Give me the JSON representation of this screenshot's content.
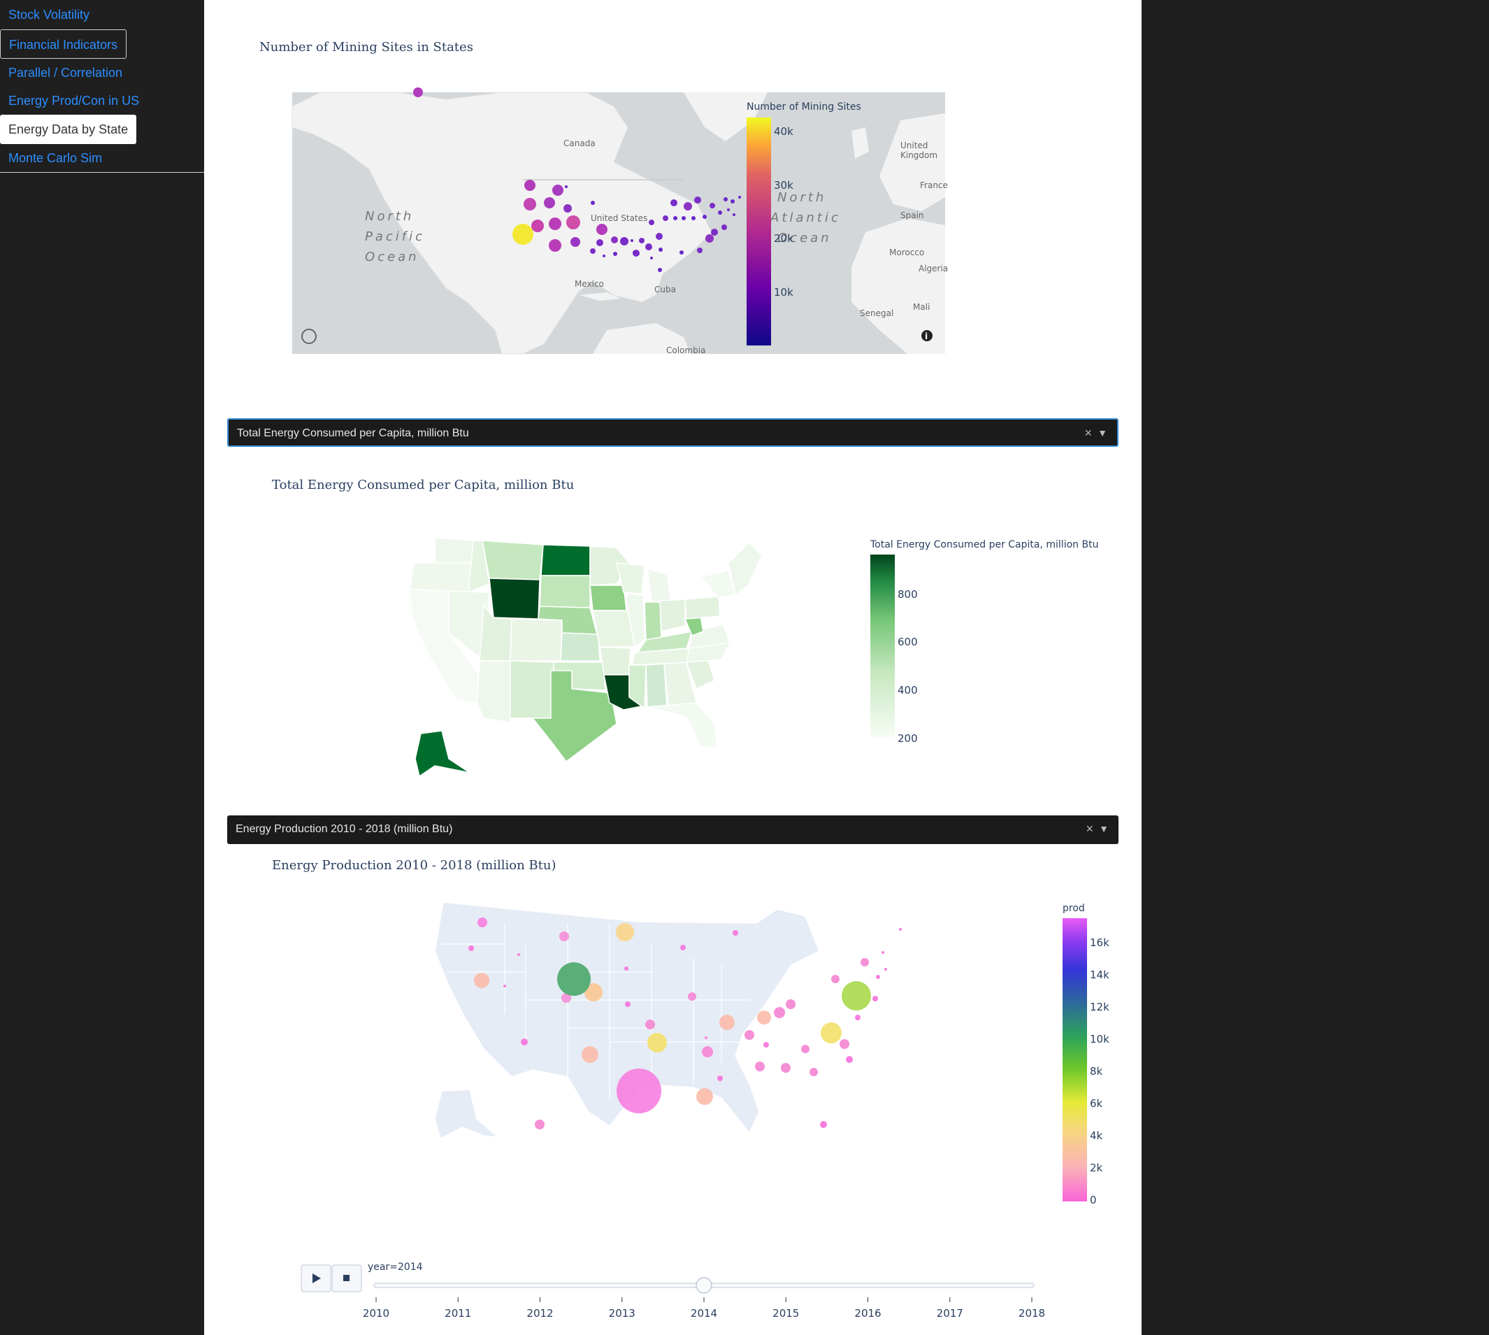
{
  "nav": {
    "items": [
      {
        "label": "Stock Volatility"
      },
      {
        "label": "Financial Indicators"
      },
      {
        "label": "Parallel / Correlation"
      },
      {
        "label": "Energy Prod/Con in US"
      },
      {
        "label": "Energy Data by State"
      },
      {
        "label": "Monte Carlo Sim"
      }
    ]
  },
  "mining_chart": {
    "title": "Number of Mining Sites in States",
    "colorbar_title": "Number of Mining Sites",
    "colorbar_ticks": [
      "40k",
      "30k",
      "20k",
      "10k"
    ],
    "map_labels": {
      "canada": "Canada",
      "united_states": "United States",
      "mexico": "Mexico",
      "cuba": "Cuba",
      "colombia": "Colombia",
      "north_pacific": [
        "North",
        "Pacific",
        "Ocean"
      ],
      "north_atlantic": [
        "North",
        "Atlantic",
        "Ocean"
      ],
      "uk": [
        "United",
        "Kingdom"
      ],
      "france": "France",
      "spain": "Spain",
      "morocco": "Morocco",
      "algeria": "Algeria",
      "senegal": "Senegal",
      "mali": "Mali"
    }
  },
  "dropdown1": {
    "value": "Total Energy Consumed per Capita, million Btu"
  },
  "choropleth_chart": {
    "title": "Total Energy Consumed per Capita, million Btu",
    "colorbar_title": "Total Energy Consumed per Capita, million Btu",
    "colorbar_ticks": [
      "800",
      "600",
      "400",
      "200"
    ]
  },
  "dropdown2": {
    "value": "Energy Production 2010 - 2018 (million Btu)"
  },
  "bubble_chart": {
    "title": "Energy Production 2010 - 2018 (million Btu)",
    "colorbar_title": "prod",
    "colorbar_ticks": [
      "16k",
      "14k",
      "12k",
      "10k",
      "8k",
      "6k",
      "4k",
      "2k",
      "0"
    ]
  },
  "slider": {
    "current_label": "year=2014",
    "years": [
      "2010",
      "2011",
      "2012",
      "2013",
      "2014",
      "2015",
      "2016",
      "2017",
      "2018"
    ],
    "current_index": 4,
    "play_icon": "play-icon",
    "stop_icon": "stop-icon"
  },
  "colors": {
    "link": "#2c8eff",
    "sidebar_bg": "#1f1f1f",
    "dropdown_bg": "#1b1b1b",
    "focus_border": "#3b8fd9"
  },
  "chart_data": [
    {
      "type": "scatter",
      "title": "Number of Mining Sites in States",
      "colorbar": {
        "title": "Number of Mining Sites",
        "range": [
          0,
          45000
        ],
        "ticks": [
          10000,
          20000,
          30000,
          40000
        ]
      },
      "note": "bubble map of mining sites per state"
    },
    {
      "type": "heatmap",
      "title": "Total Energy Consumed per Capita, million Btu",
      "colorbar": {
        "range": [
          150,
          950
        ],
        "ticks": [
          200,
          400,
          600,
          800
        ]
      },
      "highlights": {
        "Wyoming": 900,
        "Louisiana": 880,
        "North Dakota": 840,
        "Alaska": 830,
        "Texas": 470,
        "Iowa": 420,
        "Nebraska": 400,
        "West Virginia": 390
      }
    },
    {
      "type": "scatter",
      "title": "Energy Production 2010 - 2018 (million Btu)",
      "year": 2014,
      "colorbar": {
        "title": "prod",
        "range": [
          0,
          17500
        ],
        "ticks": [
          0,
          2000,
          4000,
          6000,
          8000,
          10000,
          12000,
          14000,
          16000
        ]
      },
      "approx_values": {
        "Texas": 16500,
        "Wyoming": 9800,
        "Pennsylvania": 7000,
        "West Virginia": 4000,
        "Oklahoma": 3500,
        "North Dakota": 3000,
        "Louisiana": 2500,
        "Colorado": 2200,
        "New Mexico": 2100,
        "California": 1900,
        "Illinois": 1800,
        "Kentucky": 1600,
        "Ohio": 1000
      }
    }
  ]
}
